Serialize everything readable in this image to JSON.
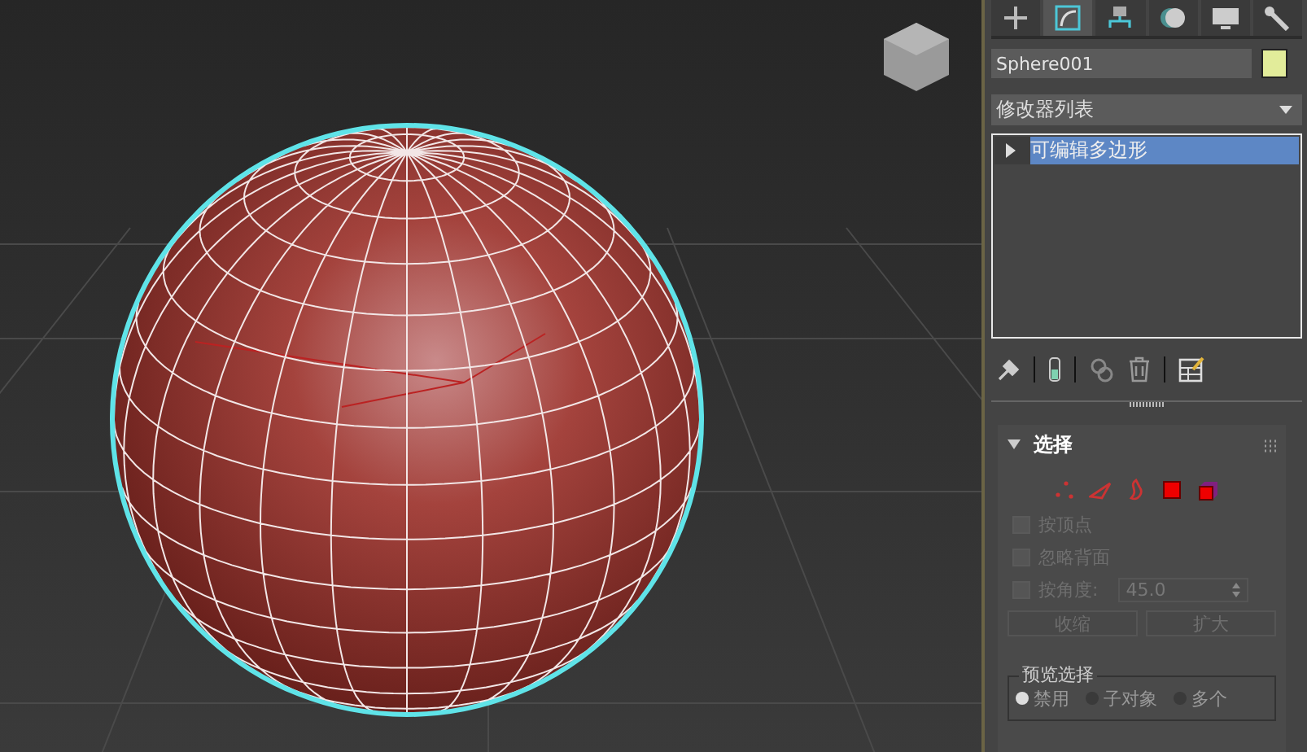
{
  "command_tabs": [
    {
      "kind": "create",
      "selected": false
    },
    {
      "kind": "modify",
      "selected": true
    },
    {
      "kind": "hierarchy",
      "selected": false
    },
    {
      "kind": "motion",
      "selected": false
    },
    {
      "kind": "display",
      "selected": false
    },
    {
      "kind": "utilities",
      "selected": false
    }
  ],
  "object_name": "Sphere001",
  "modifier_list": "修改器列表",
  "modifier_stack": [
    {
      "label": "可编辑多边形",
      "selected": true,
      "expanded": false
    }
  ],
  "rollout": {
    "title": "选择",
    "expanded": true,
    "subobject_levels": [
      {
        "kind": "vertex",
        "selected": false
      },
      {
        "kind": "edge",
        "selected": false
      },
      {
        "kind": "border",
        "selected": false
      },
      {
        "kind": "polygon",
        "selected": false
      },
      {
        "kind": "element",
        "selected": false
      }
    ],
    "checkboxes": [
      {
        "label": "按顶点",
        "checked": false,
        "disabled": true
      },
      {
        "label": "忽略背面",
        "checked": false,
        "disabled": true
      },
      {
        "label": "按角度:",
        "checked": false,
        "disabled": true
      }
    ],
    "angle_value": "45.0",
    "buttons": [
      {
        "label": "收缩",
        "disabled": true
      },
      {
        "label": "扩大",
        "disabled": true
      }
    ],
    "preview": {
      "title": "预览选择",
      "options": [
        {
          "label": "禁用",
          "selected": true
        },
        {
          "label": "子对象",
          "selected": false
        },
        {
          "label": "多个",
          "selected": false
        }
      ]
    }
  }
}
